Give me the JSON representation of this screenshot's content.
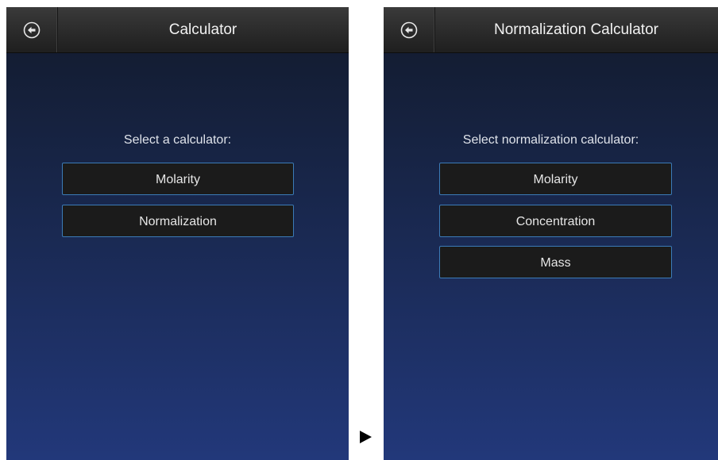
{
  "left_screen": {
    "title": "Calculator",
    "prompt": "Select a calculator:",
    "buttons": [
      "Molarity",
      "Normalization"
    ]
  },
  "right_screen": {
    "title": "Normalization Calculator",
    "prompt": "Select normalization calculator:",
    "buttons": [
      "Molarity",
      "Concentration",
      "Mass"
    ]
  },
  "icons": {
    "back": "back-arrow-icon",
    "transition": "play-arrow-icon"
  },
  "colors": {
    "titlebar": "#2c2c2c",
    "background_top": "#121a2b",
    "background_bottom": "#22387a",
    "button_fill": "#1b1b1b",
    "button_border": "#3b7bb7"
  }
}
